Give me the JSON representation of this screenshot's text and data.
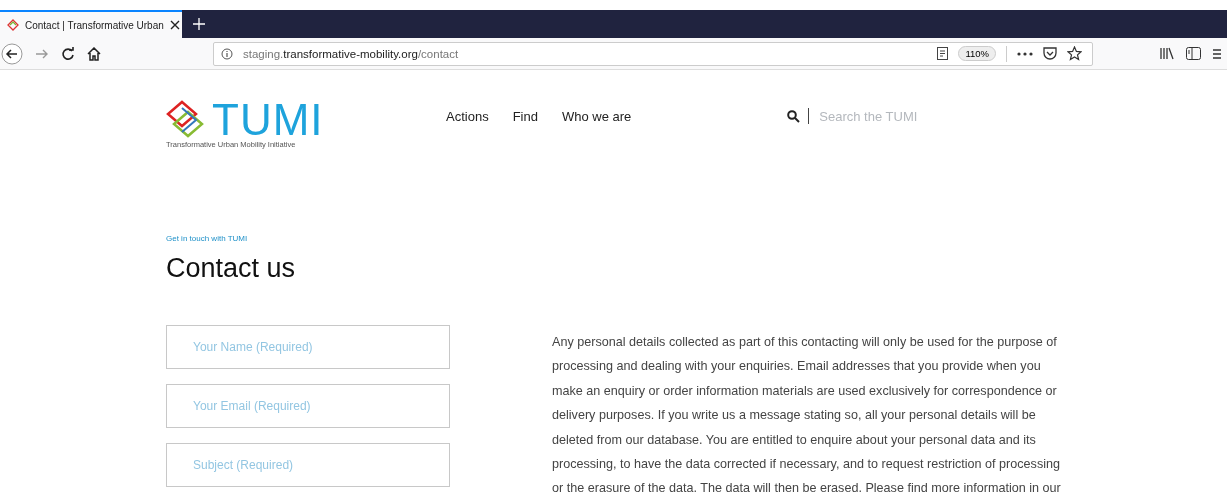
{
  "browser": {
    "tab": {
      "title": "Contact | Transformative Urban",
      "selected": true
    },
    "url": {
      "prefix": "staging.",
      "domain": "transformative-mobility.org",
      "path": "/contact"
    },
    "zoom": "110%"
  },
  "header": {
    "logo": {
      "wordmark": "TUMI",
      "tagline": "Transformative Urban Mobility Initiative"
    },
    "nav": [
      {
        "label": "Actions"
      },
      {
        "label": "Find"
      },
      {
        "label": "Who we are"
      }
    ],
    "search": {
      "placeholder": "Search the TUMI"
    }
  },
  "contact": {
    "eyebrow": "Get in touch with TUMI",
    "heading": "Contact us",
    "fields": [
      {
        "placeholder": "Your Name (Required)"
      },
      {
        "placeholder": "Your Email (Required)"
      },
      {
        "placeholder": "Subject (Required)"
      }
    ],
    "privacy_lines": [
      "Any personal details collected as part of this contacting will only be used for the purpose of",
      "processing and dealing with your enquiries. Email addresses that you provide when you",
      "make an enquiry or order information materials are used exclusively for correspondence or",
      "delivery purposes. If you write us a message stating so, all your personal details will be",
      "deleted from our database. You are entitled to enquire about your personal data and its",
      "processing, to have the data corrected if necessary, and to request restriction of processing",
      "or the erasure of the data. The data will then be erased. Please find more information in our"
    ]
  }
}
